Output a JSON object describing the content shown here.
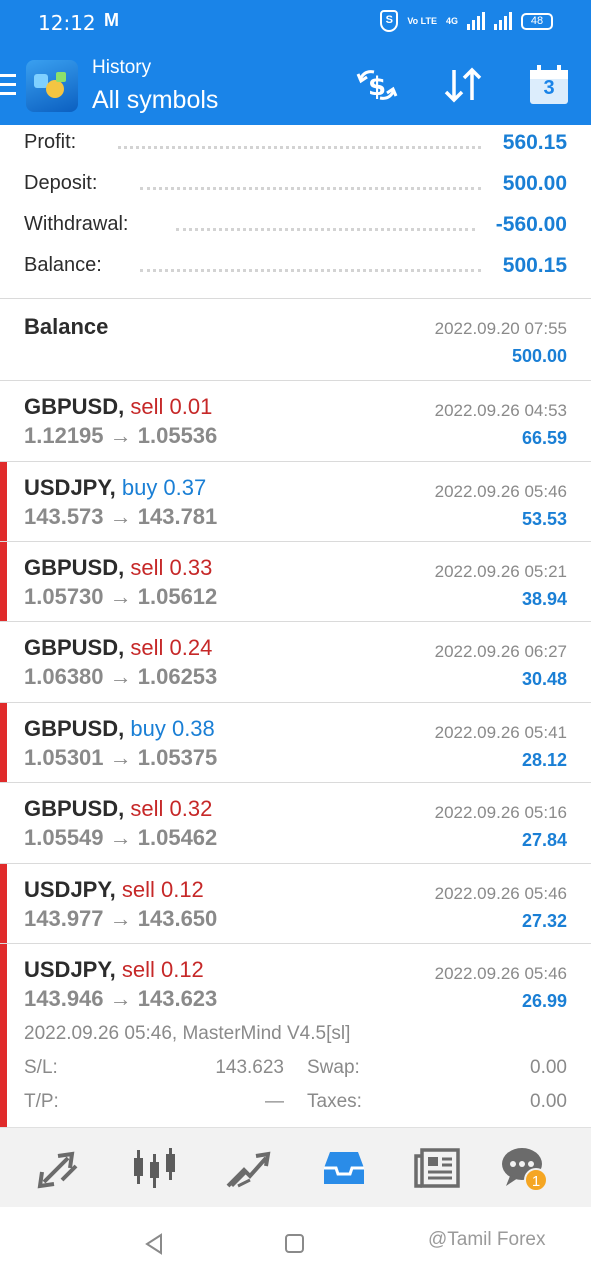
{
  "status_bar": {
    "time": "12:12",
    "mail_glyph": "M",
    "shield_glyph": "S",
    "volte": "Vo LTE",
    "network": "4G",
    "battery": "48"
  },
  "app_bar": {
    "subtitle": "History",
    "title": "All symbols",
    "calendar_day": "3"
  },
  "summary": {
    "rows": [
      {
        "label": "Profit:",
        "value": "560.15"
      },
      {
        "label": "Deposit:",
        "value": "500.00"
      },
      {
        "label": "Withdrawal:",
        "value": "-560.00"
      },
      {
        "label": "Balance:",
        "value": "500.15"
      }
    ]
  },
  "balance_entry": {
    "label": "Balance",
    "time": "2022.09.20 07:55",
    "amount": "500.00"
  },
  "deals": [
    {
      "symbol": "GBPUSD,",
      "side": "sell 0.01",
      "prices": "1.12195 → 1.05536",
      "time": "2022.09.26 04:53",
      "profit": "66.59"
    },
    {
      "symbol": "USDJPY,",
      "side": "buy 0.37",
      "prices": "143.573 → 143.781",
      "time": "2022.09.26 05:46",
      "profit": "53.53"
    },
    {
      "symbol": "GBPUSD,",
      "side": "sell 0.33",
      "prices": "1.05730 → 1.05612",
      "time": "2022.09.26 05:21",
      "profit": "38.94"
    },
    {
      "symbol": "GBPUSD,",
      "side": "sell 0.24",
      "prices": "1.06380 → 1.06253",
      "time": "2022.09.26 06:27",
      "profit": "30.48"
    },
    {
      "symbol": "GBPUSD,",
      "side": "buy 0.38",
      "prices": "1.05301 → 1.05375",
      "time": "2022.09.26 05:41",
      "profit": "28.12"
    },
    {
      "symbol": "GBPUSD,",
      "side": "sell 0.32",
      "prices": "1.05549 → 1.05462",
      "time": "2022.09.26 05:16",
      "profit": "27.84"
    },
    {
      "symbol": "USDJPY,",
      "side": "sell 0.12",
      "prices": "143.977 → 143.650",
      "time": "2022.09.26 05:46",
      "profit": "27.32"
    },
    {
      "symbol": "USDJPY,",
      "side": "sell 0.12",
      "prices": "143.946 → 143.623",
      "time": "2022.09.26 05:46",
      "profit": "26.99"
    }
  ],
  "deal_detail": {
    "comment": "2022.09.26 05:46, MasterMind V4.5[sl]",
    "sl_label": "S/L:",
    "sl_value": "143.623",
    "swap_label": "Swap:",
    "swap_value": "0.00",
    "tp_label": "T/P:",
    "tp_value": "—",
    "taxes_label": "Taxes:",
    "taxes_value": "0.00"
  },
  "bottom_nav": {
    "items": [
      "quotes-icon",
      "chart-icon",
      "trade-icon",
      "history-icon",
      "news-icon",
      "chat-icon"
    ],
    "chat_badge": "1"
  },
  "watermark": "@Tamil Forex",
  "colors": {
    "primary": "#1a84e8",
    "profit_blue": "#1a7fd5",
    "sell_red": "#c62828",
    "row_marker_red": "#e02b2b",
    "badge_orange": "#f5a623"
  }
}
